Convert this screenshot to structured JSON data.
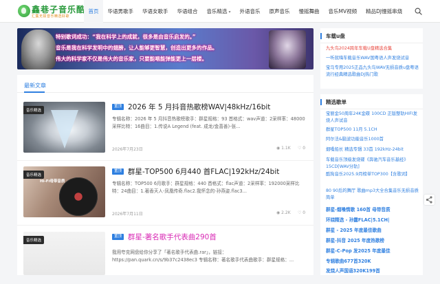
{
  "header": {
    "logo_text": "鑫巷子音乐酷",
    "logo_sub": "汇集无损音乐精选好歌"
  },
  "nav": [
    {
      "label": "首页",
      "active": true
    },
    {
      "label": "华语男歌手"
    },
    {
      "label": "华语女歌手"
    },
    {
      "label": "华语组合"
    },
    {
      "label": "音乐精选",
      "dropdown": true
    },
    {
      "label": "外语音乐"
    },
    {
      "label": "原声音乐"
    },
    {
      "label": "慢摇舞曲"
    },
    {
      "label": "音乐MV视频"
    },
    {
      "label": "精品DJ慢摇串烧"
    }
  ],
  "banner": {
    "lines": [
      "特别歌词成功：“我在科学上的成就，很多是由音乐启发的。”",
      "音乐是我在科学发明中的翅膀，让人能够更智慧，创造出更多的作品。",
      "伟大的科学家不仅是伟大的音乐家，只要能唱能弹能更上一层楼。"
    ]
  },
  "main": {
    "section_title": "最新文章",
    "posts": [
      {
        "thumb_badge": "音乐精选",
        "tag": "置顶",
        "title": "2026 年 5 月抖音热歌榜WAV|48kHz/16bit",
        "excerpt": "专辑名称：2026 年 5 月抖音热歌榜歌手：群星规格：93 首格式：wav声道：2采样率：48000采样比特：16曲目：1.传说A Legend (feat. 成龙/金喜善)-张...",
        "date": "2026年7月23日",
        "views": "1.1K",
        "likes": "0"
      },
      {
        "thumb_badge": "音乐精选",
        "thumb_caption": "Hi-Fi母带音质",
        "tag": "置顶",
        "title": "群星-TOP500 6月440 首FLAC|192kHz/24bit",
        "excerpt": "专辑名称：TOP500 6月歌手：群星规格：440 首格式：flac声道：2采样率：192000采样比特：24曲目：1.著香天人-凤凰传奇.flac2.我怀念的-孙燕姿.flac3...",
        "date": "2026年7月11日",
        "views": "2.2K",
        "likes": "0"
      },
      {
        "thumb_badge": "音乐精选",
        "tag": "置顶",
        "title": "群星-著名歌手代表曲290首",
        "excerpt": "我用夸克网盘给你分享了「著名歌手代表曲.rar」，链接：https://pan.quark.cn/s/9b37c2438ec3 专辑名称：著名歌手代表曲歌手：群星规格：..."
      }
    ]
  },
  "sidebar": {
    "car_title": "车载u盘",
    "car_links": [
      {
        "text": "九头鸟2024跨年车载U盘精选合集",
        "color": "red"
      },
      {
        "text": "一听就嗨车载音乐WAV国粤语人声发烧试音"
      },
      {
        "text": "宝马专用2025正品九头鸟WAV无损音质u盘粤语流行经典精选歌曲DJ热门歌"
      }
    ],
    "album_title": "精选歌单",
    "album_links": [
      {
        "text": "宝丽金50周年24K金碟 100CD 正版整轨HIFI发烧人声试音"
      },
      {
        "text": "群星TOP500 11月 5.1CH"
      },
      {
        "text": "阿尔法&脑波功能音乐1000首"
      },
      {
        "text": "烟嗓船长 精选专辑 33首 192kHz-24bit"
      },
      {
        "text": "车载音乐顶级发烧碟《奔驰汽车音乐基经》15CD[WAV分轨]"
      },
      {
        "text": "酷狗音乐2025.9月榜单TOP300【含歌词】"
      },
      {
        "text": "80 90后的舞厅 歌曲mp3大全合集音乐无损音质简单"
      },
      {
        "text": "群星-烟嗓情歌 160首 母带音质",
        "bold": true
      },
      {
        "text": "环绕精选 - 孙露FLAC|5.1CH|",
        "bold": true
      },
      {
        "text": "群星 - 2025 年度最佳歌曲",
        "bold": true
      },
      {
        "text": "群星-抖音 2025 年度热歌榜",
        "bold": true
      },
      {
        "text": "群星-C-Pop 发2025 年度最佳",
        "bold": true
      },
      {
        "text": "专辑歌曲677首320K",
        "bold": true
      },
      {
        "text": "发烧人声国语320K199首",
        "bold": true
      }
    ]
  }
}
